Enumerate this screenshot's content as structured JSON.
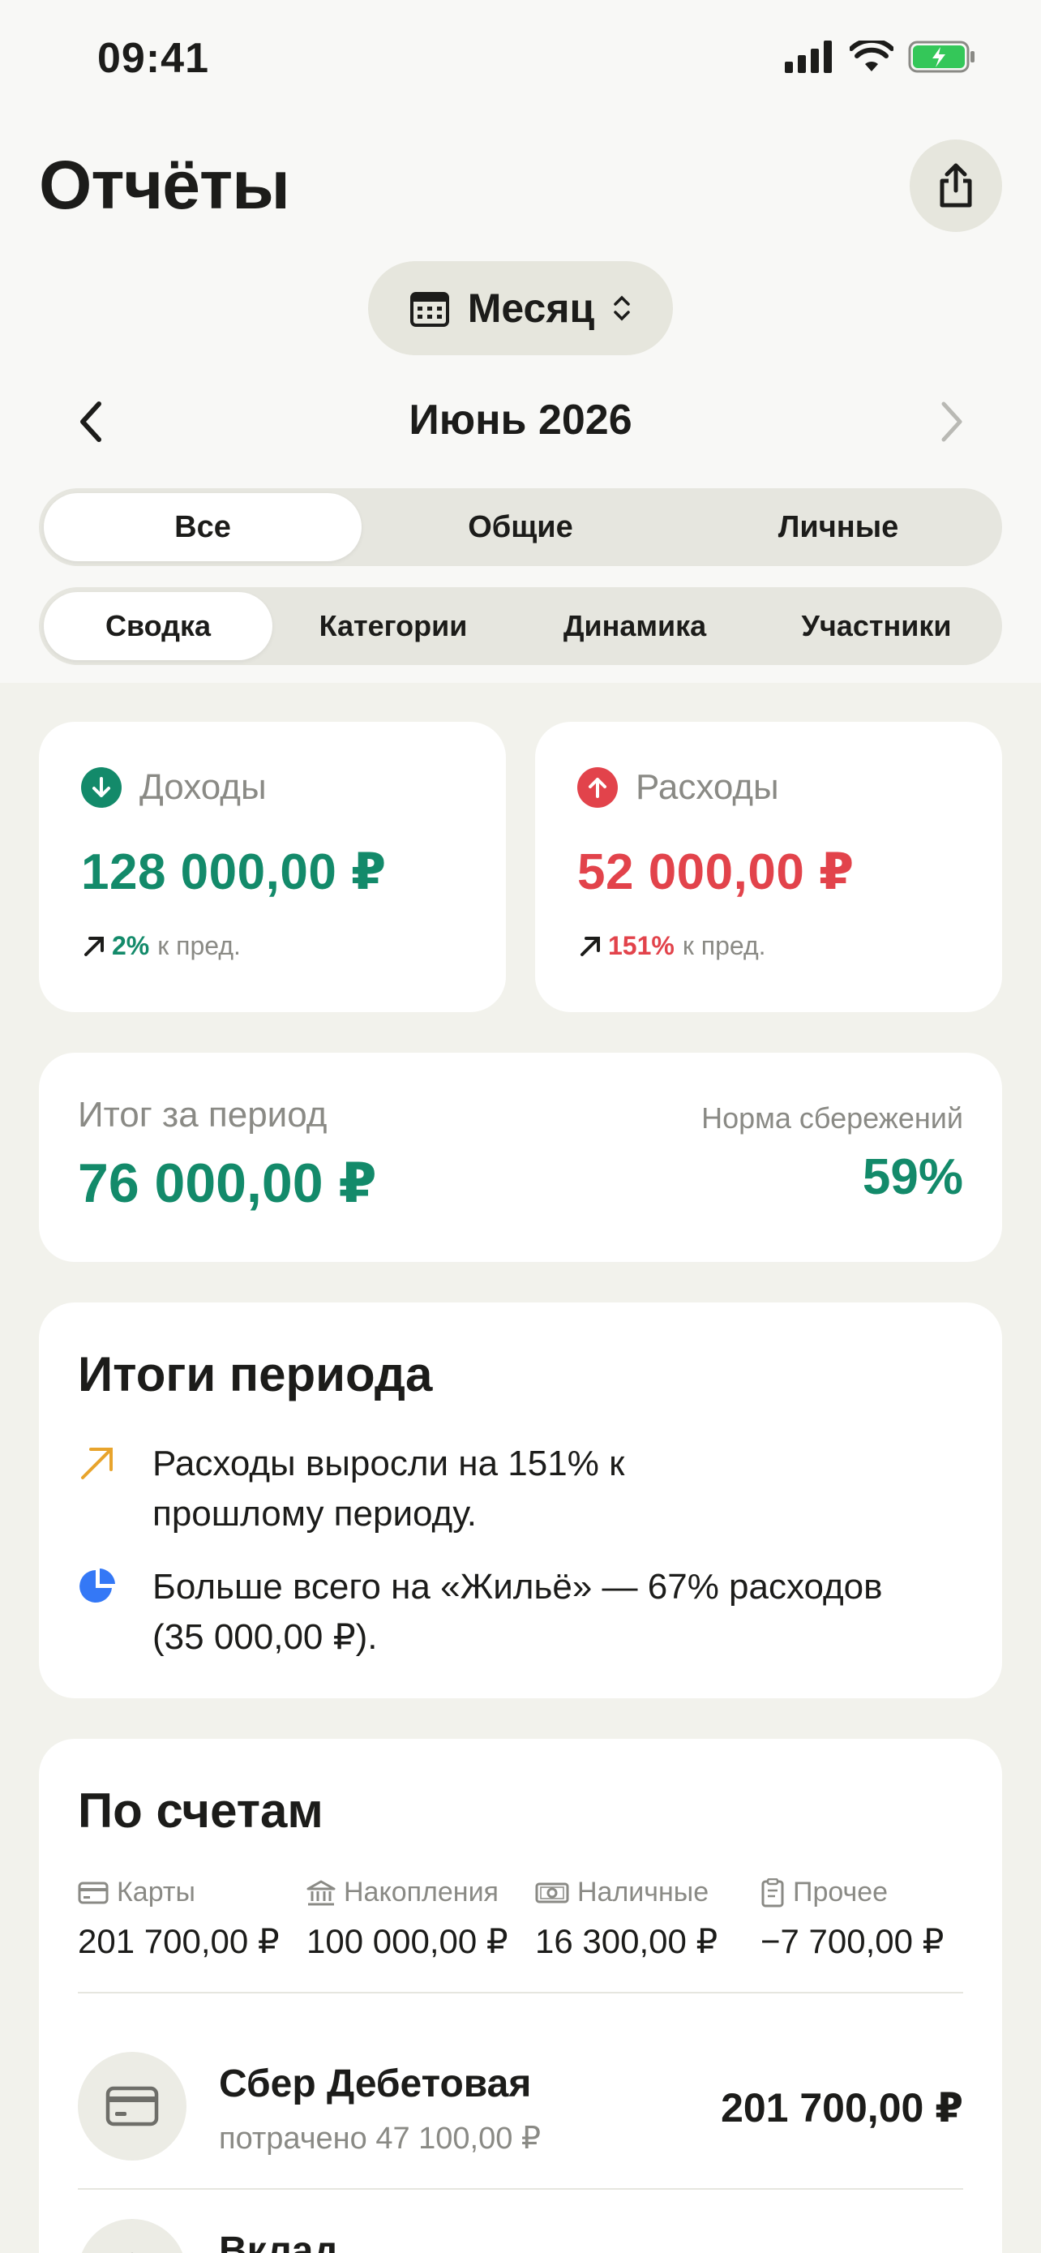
{
  "status": {
    "time": "09:41"
  },
  "header": {
    "title": "Отчёты"
  },
  "period": {
    "mode_label": "Месяц",
    "current": "Июнь 2026"
  },
  "scope_tabs": [
    {
      "label": "Все",
      "active": true
    },
    {
      "label": "Общие",
      "active": false
    },
    {
      "label": "Личные",
      "active": false
    }
  ],
  "view_tabs": [
    {
      "label": "Сводка",
      "active": true
    },
    {
      "label": "Категории",
      "active": false
    },
    {
      "label": "Динамика",
      "active": false
    },
    {
      "label": "Участники",
      "active": false
    }
  ],
  "income": {
    "label": "Доходы",
    "value": "128 000,00 ₽",
    "change_pct": "2%",
    "change_ctx": "к пред."
  },
  "expense": {
    "label": "Расходы",
    "value": "52 000,00 ₽",
    "change_pct": "151%",
    "change_ctx": "к пред."
  },
  "total": {
    "label": "Итог за период",
    "value": "76 000,00 ₽",
    "rate_label": "Норма сбережений",
    "rate_value": "59%"
  },
  "insights": {
    "title": "Итоги периода",
    "items": [
      {
        "icon": "trend-up-icon",
        "text": "Расходы выросли на 151% к прошлому периоду."
      },
      {
        "icon": "pie-chart-icon",
        "text": "Больше всего на «Жильё» — 67% расходов (35 000,00 ₽)."
      }
    ]
  },
  "accounts": {
    "title": "По счетам",
    "summary": [
      {
        "icon": "card-icon",
        "label": "Карты",
        "amount": "201 700,00 ₽"
      },
      {
        "icon": "bank-icon",
        "label": "Накопления",
        "amount": "100 000,00 ₽"
      },
      {
        "icon": "cash-icon",
        "label": "Наличные",
        "amount": "16 300,00 ₽"
      },
      {
        "icon": "receipt-icon",
        "label": "Прочее",
        "amount": "−7 700,00 ₽"
      }
    ],
    "list": [
      {
        "icon": "card-icon",
        "name": "Сбер Дебетовая",
        "sub": "потрачено 47 100,00 ₽",
        "balance": "201 700,00 ₽"
      },
      {
        "icon": "bank-icon",
        "name": "Вклад",
        "sub": "",
        "balance": ""
      }
    ]
  },
  "colors": {
    "income": "#138a6a",
    "expense": "#e2434b",
    "insight_up": "#e8a42c",
    "insight_pie": "#3478f6"
  }
}
